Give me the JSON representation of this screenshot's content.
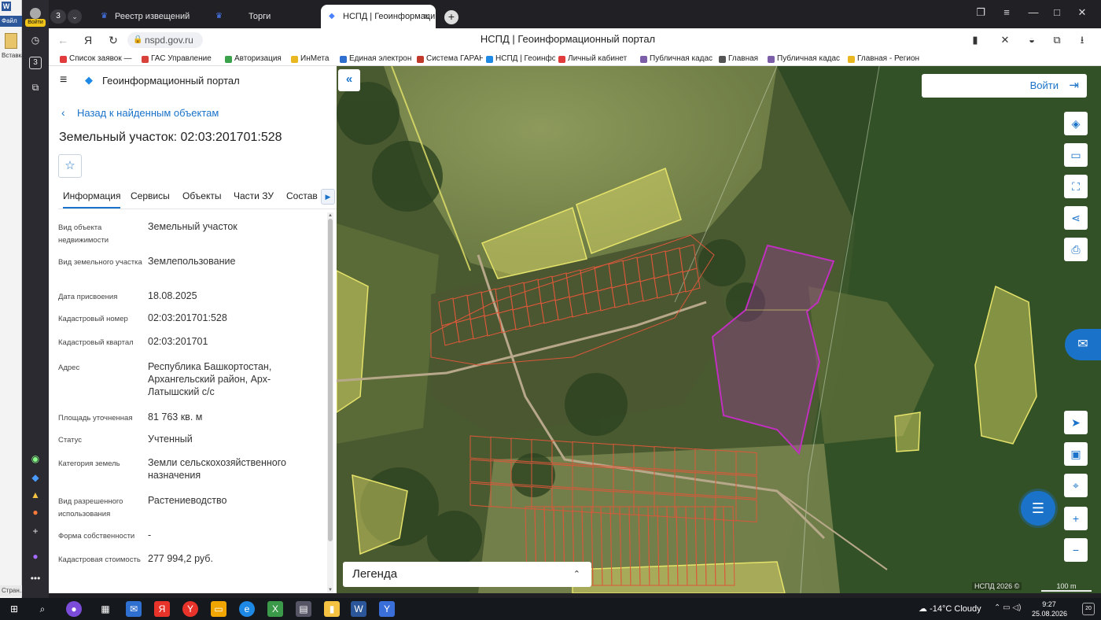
{
  "word_app": {
    "file_label": "Файл",
    "paste_label": "Вставка",
    "status_label": "Стран..."
  },
  "browser_rail": {
    "login_label": "Войти",
    "tab_counter": "3"
  },
  "tabs": [
    {
      "title": "Реестр извещений",
      "active": false
    },
    {
      "title": "Торги",
      "active": false
    },
    {
      "title": "НСПД | Геоинформаци",
      "active": true
    }
  ],
  "tab_count": "3",
  "address_bar": {
    "url": "nspd.gov.ru",
    "page_title": "НСПД | Геоинформационный портал"
  },
  "bookmarks": [
    {
      "label": "Список заявок —",
      "color": "#e23b3b"
    },
    {
      "label": "ГАС Управление",
      "color": "#d9423a"
    },
    {
      "label": "Авторизация",
      "color": "#3aa24a"
    },
    {
      "label": "ИнМета",
      "color": "#e9b820"
    },
    {
      "label": "Единая электрон",
      "color": "#2f6fcf"
    },
    {
      "label": "Система ГАРАНТ.",
      "color": "#c0392b"
    },
    {
      "label": "НСПД | Геоинфор",
      "color": "#1e88e5"
    },
    {
      "label": "Личный кабинет",
      "color": "#e23b3b"
    },
    {
      "label": "Публичная кадас",
      "color": "#7b5ea7"
    },
    {
      "label": "Главная",
      "color": "#555555"
    },
    {
      "label": "Публичная кадас",
      "color": "#7b5ea7"
    },
    {
      "label": "Главная - Регион",
      "color": "#e9b820"
    }
  ],
  "panel": {
    "portal_name": "Геоинформационный портал",
    "back_link": "Назад к найденным объектам",
    "title": "Земельный участок: 02:03:201701:528",
    "tabs": [
      "Информация",
      "Сервисы",
      "Объекты",
      "Части ЗУ",
      "Состав"
    ],
    "attributes": [
      {
        "key": "Вид объекта недвижимости",
        "value": "Земельный участок"
      },
      {
        "key": "Вид земельного участка",
        "value": "Землепользование"
      },
      {
        "key": "Дата присвоения",
        "value": "18.08.2025"
      },
      {
        "key": "Кадастровый номер",
        "value": "02:03:201701:528"
      },
      {
        "key": "Кадастровый квартал",
        "value": "02:03:201701"
      },
      {
        "key": "Адрес",
        "value": "Республика Башкортостан, Архангельский район, Арх-Латышский с/с"
      },
      {
        "key": "Площадь уточненная",
        "value": "81 763 кв. м"
      },
      {
        "key": "Статус",
        "value": "Учтенный"
      },
      {
        "key": "Категория земель",
        "value": "Земли сельскохозяйственного назначения"
      },
      {
        "key": "Вид разрешенного использования",
        "value": "Растениеводство"
      },
      {
        "key": "Форма собственности",
        "value": "-"
      },
      {
        "key": "Кадастровая стоимость",
        "value": "277 994,2 руб."
      }
    ]
  },
  "map": {
    "login_label": "Войти",
    "legend_label": "Легенда",
    "copyright": "НСПД 2026 ©",
    "scale_label": "100 m",
    "colors": {
      "highlight": "#c02fc0",
      "parcels": "#d9583a",
      "fields": "#e6e36a"
    }
  },
  "taskbar": {
    "weather_temp": "-14°C",
    "weather_desc": "Cloudy",
    "time": "9:27",
    "date": "25.08.2026",
    "notifications": "20"
  }
}
